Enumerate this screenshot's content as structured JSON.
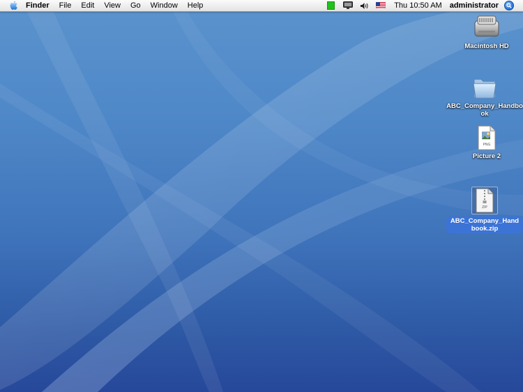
{
  "menubar": {
    "apple_icon": "apple-logo-icon",
    "app_name": "Finder",
    "menus": [
      "File",
      "Edit",
      "View",
      "Go",
      "Window",
      "Help"
    ],
    "status_icons": [
      "battery-icon",
      "display-icon",
      "volume-icon",
      "us-flag-icon"
    ],
    "clock": "Thu 10:50 AM",
    "user": "administrator",
    "spotlight_icon": "spotlight-icon"
  },
  "desktop": {
    "icons": [
      {
        "label": "Macintosh HD",
        "icon": "hard-drive-icon",
        "selected": false
      },
      {
        "label": "ABC_Company_Handbook",
        "icon": "folder-icon",
        "selected": false
      },
      {
        "label": "Picture 2",
        "icon": "png-file-icon",
        "selected": false
      },
      {
        "label": "ABC_Company_Handbook.zip",
        "icon": "zip-file-icon",
        "selected": true
      }
    ]
  },
  "colors": {
    "wallpaper_top": "#5b93cd",
    "wallpaper_bottom": "#27489a",
    "selection": "#3b73d6",
    "battery": "#22c21b"
  }
}
